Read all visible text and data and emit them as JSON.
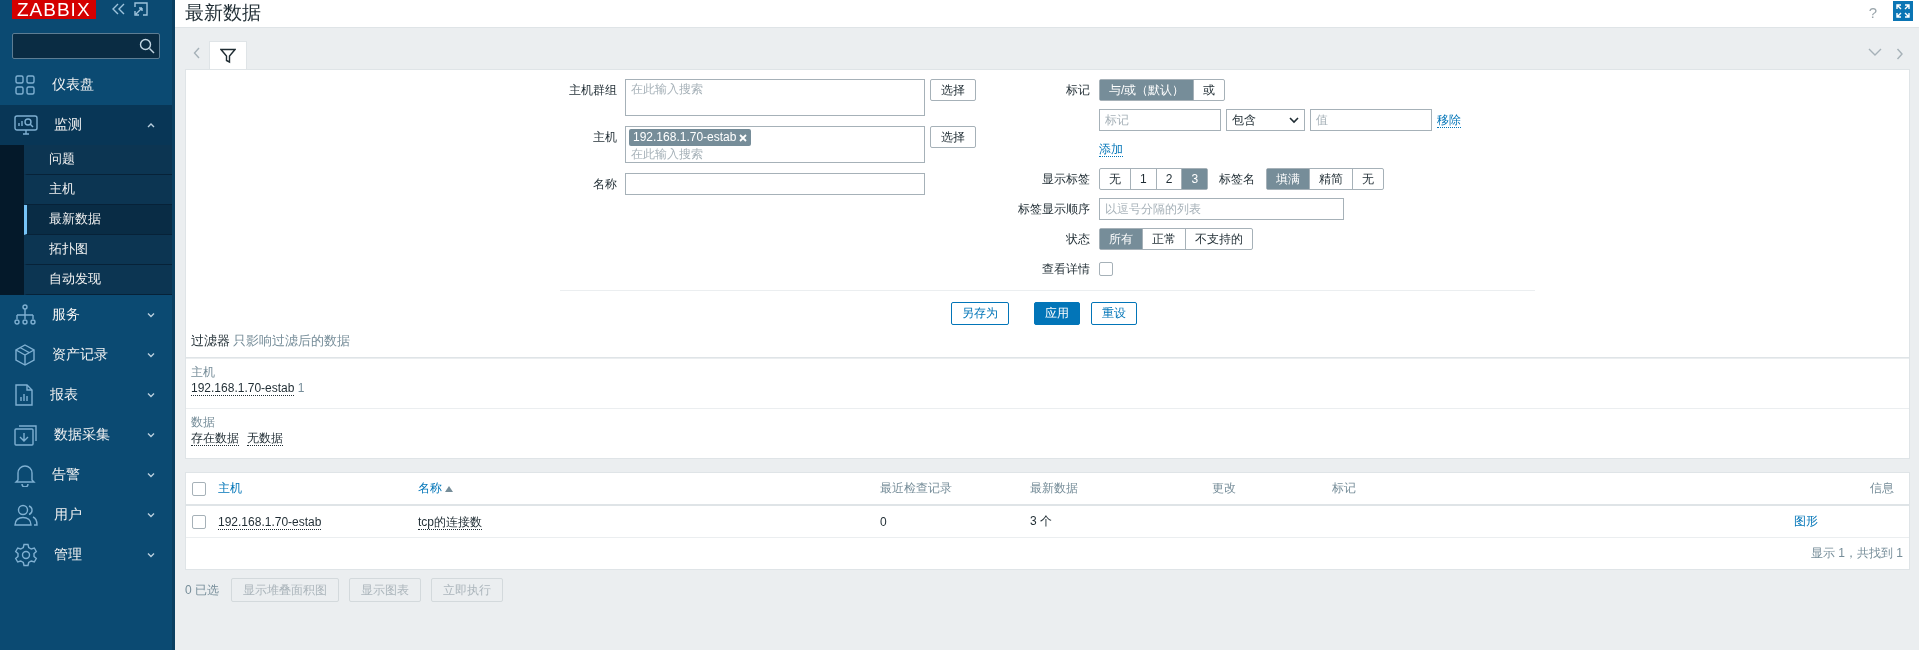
{
  "sidebar": {
    "logo": "ZABBIX",
    "menu": [
      {
        "kind": "link",
        "label": "仪表盘"
      },
      {
        "kind": "group",
        "label": "监测",
        "expanded": true,
        "children": [
          {
            "label": "问题",
            "selected": false
          },
          {
            "label": "主机",
            "selected": false
          },
          {
            "label": "最新数据",
            "selected": true
          },
          {
            "label": "拓扑图",
            "selected": false
          },
          {
            "label": "自动发现",
            "selected": false
          }
        ]
      },
      {
        "kind": "group",
        "label": "服务",
        "expanded": false
      },
      {
        "kind": "group",
        "label": "资产记录",
        "expanded": false
      },
      {
        "kind": "group",
        "label": "报表",
        "expanded": false
      },
      {
        "kind": "group",
        "label": "数据采集",
        "expanded": false
      },
      {
        "kind": "group",
        "label": "告警",
        "expanded": false
      },
      {
        "kind": "group",
        "label": "用户",
        "expanded": false
      },
      {
        "kind": "group",
        "label": "管理",
        "expanded": false
      }
    ]
  },
  "header": {
    "title": "最新数据",
    "help": "?"
  },
  "filter": {
    "tabs": [
      {
        "selected": true
      }
    ],
    "left_fields": [
      {
        "kind": "multiselect",
        "label": "主机群组",
        "placeholder": "在此输入搜索",
        "button": "选择"
      },
      {
        "kind": "multiselect",
        "label": "主机",
        "chips": [
          "192.168.1.70-estab"
        ],
        "placeholder": "在此输入搜索",
        "button": "选择"
      },
      {
        "kind": "text",
        "label": "名称"
      }
    ],
    "tags": {
      "label": "标记",
      "operators": [
        {
          "label": "与/或（默认）",
          "selected": true
        },
        {
          "label": "或",
          "selected": false
        }
      ],
      "row": {
        "tag_placeholder": "标记",
        "operator": "包含",
        "value_placeholder": "值",
        "remove": "移除"
      },
      "add": "添加"
    },
    "show_tags": {
      "label": "显示标签",
      "options": [
        {
          "label": "无",
          "selected": false
        },
        {
          "label": "1",
          "selected": false
        },
        {
          "label": "2",
          "selected": false
        },
        {
          "label": "3",
          "selected": true
        }
      ],
      "name_label": "标签名",
      "name_options": [
        {
          "label": "填满",
          "selected": true
        },
        {
          "label": "精简",
          "selected": false
        },
        {
          "label": "无",
          "selected": false
        }
      ]
    },
    "tag_priority": {
      "label": "标签显示顺序",
      "placeholder": "以逗号分隔的列表"
    },
    "state": {
      "label": "状态",
      "options": [
        {
          "label": "所有",
          "selected": true
        },
        {
          "label": "正常",
          "selected": false
        },
        {
          "label": "不支持的",
          "selected": false
        }
      ]
    },
    "details": {
      "label": "查看详情",
      "checked": false
    },
    "buttons": [
      {
        "kind": "outline",
        "label": "另存为"
      },
      {
        "kind": "primary",
        "label": "应用"
      },
      {
        "kind": "outline",
        "label": "重设"
      }
    ],
    "note": {
      "title": "过滤器",
      "text": "只影响过滤后的数据"
    }
  },
  "subfilter": [
    {
      "label": "主机",
      "items": [
        {
          "label": "192.168.1.70-estab",
          "count": "1"
        }
      ]
    },
    {
      "label": "数据",
      "items": [
        {
          "label": "存在数据"
        },
        {
          "label": "无数据"
        }
      ]
    }
  ],
  "table": {
    "select_all": {
      "checked": false
    },
    "columns": [
      {
        "label": "主机",
        "kind": "link",
        "sorted": false
      },
      {
        "label": "名称",
        "kind": "link",
        "sorted": true
      },
      {
        "label": "最近检查记录",
        "kind": "plain",
        "sorted": false
      },
      {
        "label": "最新数据",
        "kind": "plain",
        "sorted": false
      },
      {
        "label": "更改",
        "kind": "plain",
        "sorted": false
      },
      {
        "label": "标记",
        "kind": "plain",
        "sorted": false
      },
      {
        "label": "信息",
        "kind": "plain",
        "sorted": false
      }
    ],
    "rows": [
      {
        "checked": false,
        "host": "192.168.1.70-estab",
        "name": "tcp的连接数",
        "last_check": "0",
        "last_value": "3 个",
        "info": "图形"
      }
    ],
    "footer": "显示 1，共找到 1"
  },
  "actions": {
    "selected_count": "0 已选",
    "buttons": [
      {
        "label": "显示堆叠面积图",
        "disabled": true
      },
      {
        "label": "显示图表",
        "disabled": true
      },
      {
        "label": "立即执行",
        "disabled": true
      }
    ]
  }
}
